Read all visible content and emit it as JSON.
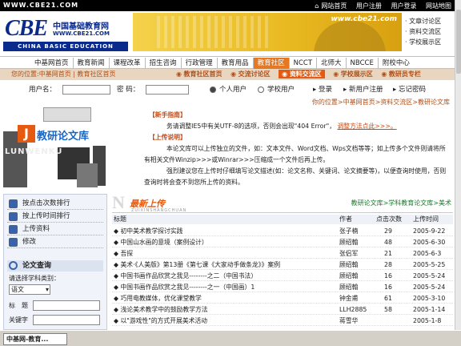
{
  "top": {
    "url": "WWW.CBE21.COM",
    "links": [
      "网站首页",
      "用户注册",
      "用户登录",
      "网站地图"
    ]
  },
  "logo": {
    "brand": "CBE",
    "cn": "中国基础教育网",
    "url": "WWW.CBE21.COM",
    "en": "CHINA BASIC EDUCATION"
  },
  "banner": {
    "url": "www.cbe21.com"
  },
  "right_links": [
    "文章讨论区",
    "资料交流区",
    "学校展示区"
  ],
  "nav": [
    "中基网首页",
    "教育新闻",
    "课程改革",
    "招生咨询",
    "行政管理",
    "教育用品",
    "教育社区",
    "NCCT",
    "北师大",
    "NBCCE",
    "附校中心"
  ],
  "nav_active": "教育社区",
  "sub": {
    "breadcrumb": "您的位置:中基网首页 | 教育社区首页",
    "tabs": [
      "教育社区首页",
      "交流讨论区",
      "资料交流区",
      "学校展示区",
      "教研员专栏"
    ],
    "active": "资料交流区"
  },
  "login": {
    "user_label": "用户名：",
    "pass_label": "密 码：",
    "personal": "个人用户",
    "school": "学校用户",
    "login": "登录",
    "register": "新用户注册",
    "forgot": "忘记密码"
  },
  "crumb": "你的位置>中基网首页>资料交流区>教研论文库",
  "feat": {
    "title": "教研论文库",
    "j": "J",
    "lunwen": "LUNWENKU"
  },
  "notes": {
    "h1": "【新手指南】",
    "p1": "务请调整IE5中有关UTF-8的选项，否则会出现\"404 Error\"，",
    "p1_link": "调整方法点此>>>。",
    "h2": "【上传说明】",
    "p2": "本论文库可以上传独立的文件，如：文本文件、Word文档、Wps文档等等；如上传多个文件则请将所有相关文件Winzip>>>或Winrar>>>压缩成一个文件后再上传。",
    "p3": "强烈建议您在上传时仔细填写论文描述(如：论文名称、关键词、论文摘要等)，以便查询时使用，否则查询时将会查不到您所上传的资料。"
  },
  "left": {
    "items": [
      "按点击次数排行",
      "按上传时间排行",
      "上传资料",
      "修改"
    ],
    "search_title": "论文查询",
    "select_label": "请选择学科类别：",
    "select_value": "语文",
    "title_label": "标　题",
    "keyword_label": "关键字"
  },
  "main": {
    "title": "最新上传",
    "pinyin": "ZUIXINSHANGCHUAN",
    "bc": "教研论文库>学科教育论文库>美术",
    "headers": [
      "标题",
      "作者",
      "点击次数",
      "上传时间"
    ],
    "rows": [
      [
        "初中美术教学探讨实践",
        "张子楠",
        "29",
        "2005-9-22"
      ],
      [
        "中国山水画的意境（案例设计）",
        "顾绍翰",
        "48",
        "2005-6-30"
      ],
      [
        "吾探",
        "张侣军",
        "21",
        "2005-6-3"
      ],
      [
        "美术·《人美版》第13册《第七课《大家动手做条龙》》案例",
        "顾绍翰",
        "28",
        "2005-5-25"
      ],
      [
        "中国书画作品欣赏之我见--------之二（中国书法）",
        "顾绍翰",
        "16",
        "2005-5-24"
      ],
      [
        "中国书画作品欣赏之我见--------之一（中国画）1",
        "顾绍翰",
        "16",
        "2005-5-24"
      ],
      [
        "巧用电教媒体，优化课堂教学",
        "钟金甫",
        "61",
        "2005-3-10"
      ],
      [
        "浅论美术教学中的鼓励教学方法",
        "LLH2885",
        "58",
        "2005-1-14"
      ],
      [
        "以\"游戏性\"的方式开展美术活动",
        "蒋雪华",
        "",
        "2005-1-8"
      ]
    ]
  },
  "status": {
    "tab": "中基网-教育..."
  }
}
